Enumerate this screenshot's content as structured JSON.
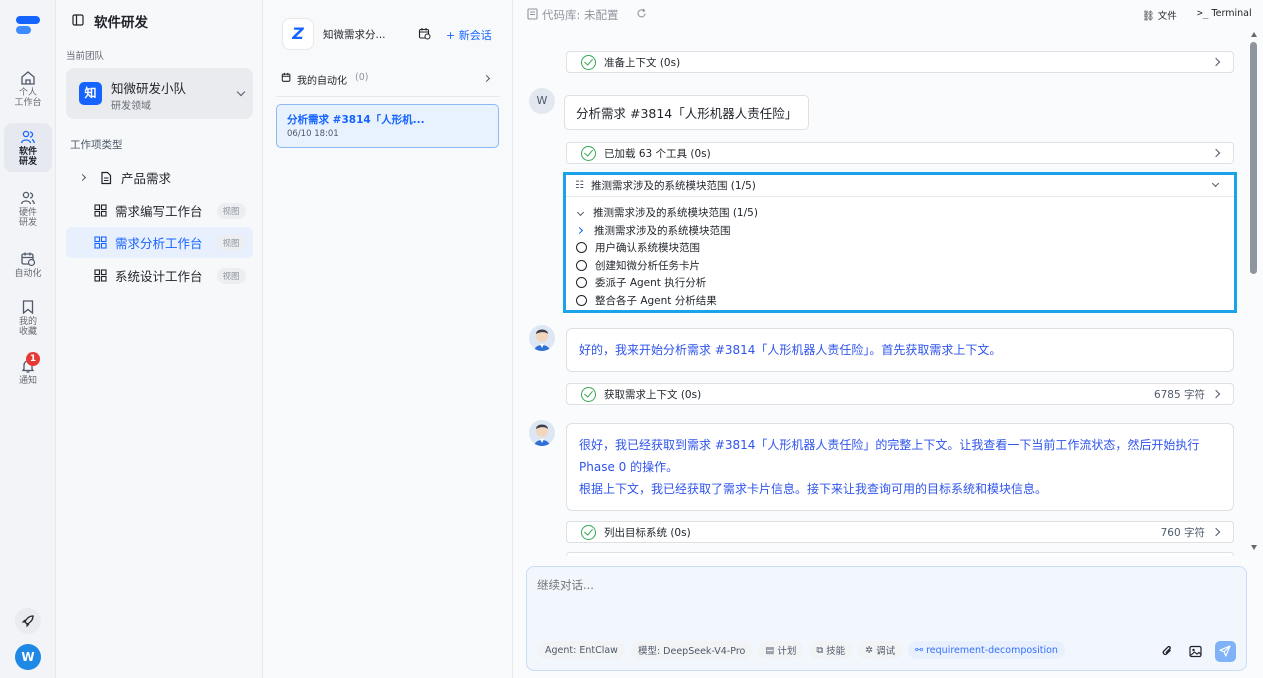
{
  "rail": {
    "items": [
      {
        "label1": "个人",
        "label2": "工作台"
      },
      {
        "label1": "软件",
        "label2": "研发"
      },
      {
        "label1": "硬件",
        "label2": "研发"
      },
      {
        "label1": "自动化",
        "label2": ""
      },
      {
        "label1": "我的",
        "label2": "收藏"
      },
      {
        "label1": "通知",
        "label2": ""
      }
    ],
    "notify_count": "1",
    "user_initial": "W"
  },
  "team": {
    "title": "软件研发",
    "current_team_label": "当前团队",
    "team_name": "知微研发小队",
    "team_domain": "研发领域",
    "team_badge": "知",
    "work_types_label": "工作项类型",
    "product_req": "产品需求",
    "workbenches": [
      {
        "label": "需求编写工作台",
        "tag": "视图"
      },
      {
        "label": "需求分析工作台",
        "tag": "视图"
      },
      {
        "label": "系统设计工作台",
        "tag": "视图"
      }
    ]
  },
  "conv": {
    "agent_name": "知微需求分...",
    "new_chat": "+ 新会话",
    "automation_label": "我的自动化",
    "automation_count": "(0)",
    "session_title": "分析需求 #3814「人形机...",
    "session_time": "06/10 18:01"
  },
  "topbar": {
    "repo": "代码库: 未配置",
    "files": "文件",
    "terminal": "Terminal"
  },
  "chat": {
    "step_prepare": "准备上下文 (0s)",
    "user_initial": "W",
    "user_msg": "分析需求 #3814「人形机器人责任险」",
    "step_tools": "已加载 63 个工具 (0s)",
    "plan_title": "推测需求涉及的系统模块范围 (1/5)",
    "plan_group": "推测需求涉及的系统模块范围 (1/5)",
    "plan_current": "推测需求涉及的系统模块范围",
    "plan_items": [
      "用户确认系统模块范围",
      "创建知微分析任务卡片",
      "委派子 Agent 执行分析",
      "整合各子 Agent 分析结果"
    ],
    "reply1": "好的，我来开始分析需求 #3814「人形机器人责任险」。首先获取需求上下文。",
    "step_context": "获取需求上下文 (0s)",
    "step_context_size": "6785 字符",
    "reply2_line1": "很好，我已经获取到需求 #3814「人形机器人责任险」的完整上下文。让我查看一下当前工作流状态，然后开始执行",
    "reply2_line2": "Phase 0 的操作。",
    "reply2_line3": "根据上下文，我已经获取了需求卡片信息。接下来让我查询可用的目标系统和模块信息。",
    "step_systems": "列出目标系统 (0s)",
    "step_systems_size": "760 字符"
  },
  "input": {
    "placeholder": "继续对话...",
    "chips": [
      "Agent: EntClaw",
      "模型: DeepSeek-V4-Pro",
      "计划",
      "技能",
      "调试",
      "requirement-decomposition"
    ]
  },
  "colors": {
    "accent": "#1664ff",
    "highlight_border": "#1aa3e8",
    "success": "#34a853",
    "badge": "#e53935"
  }
}
